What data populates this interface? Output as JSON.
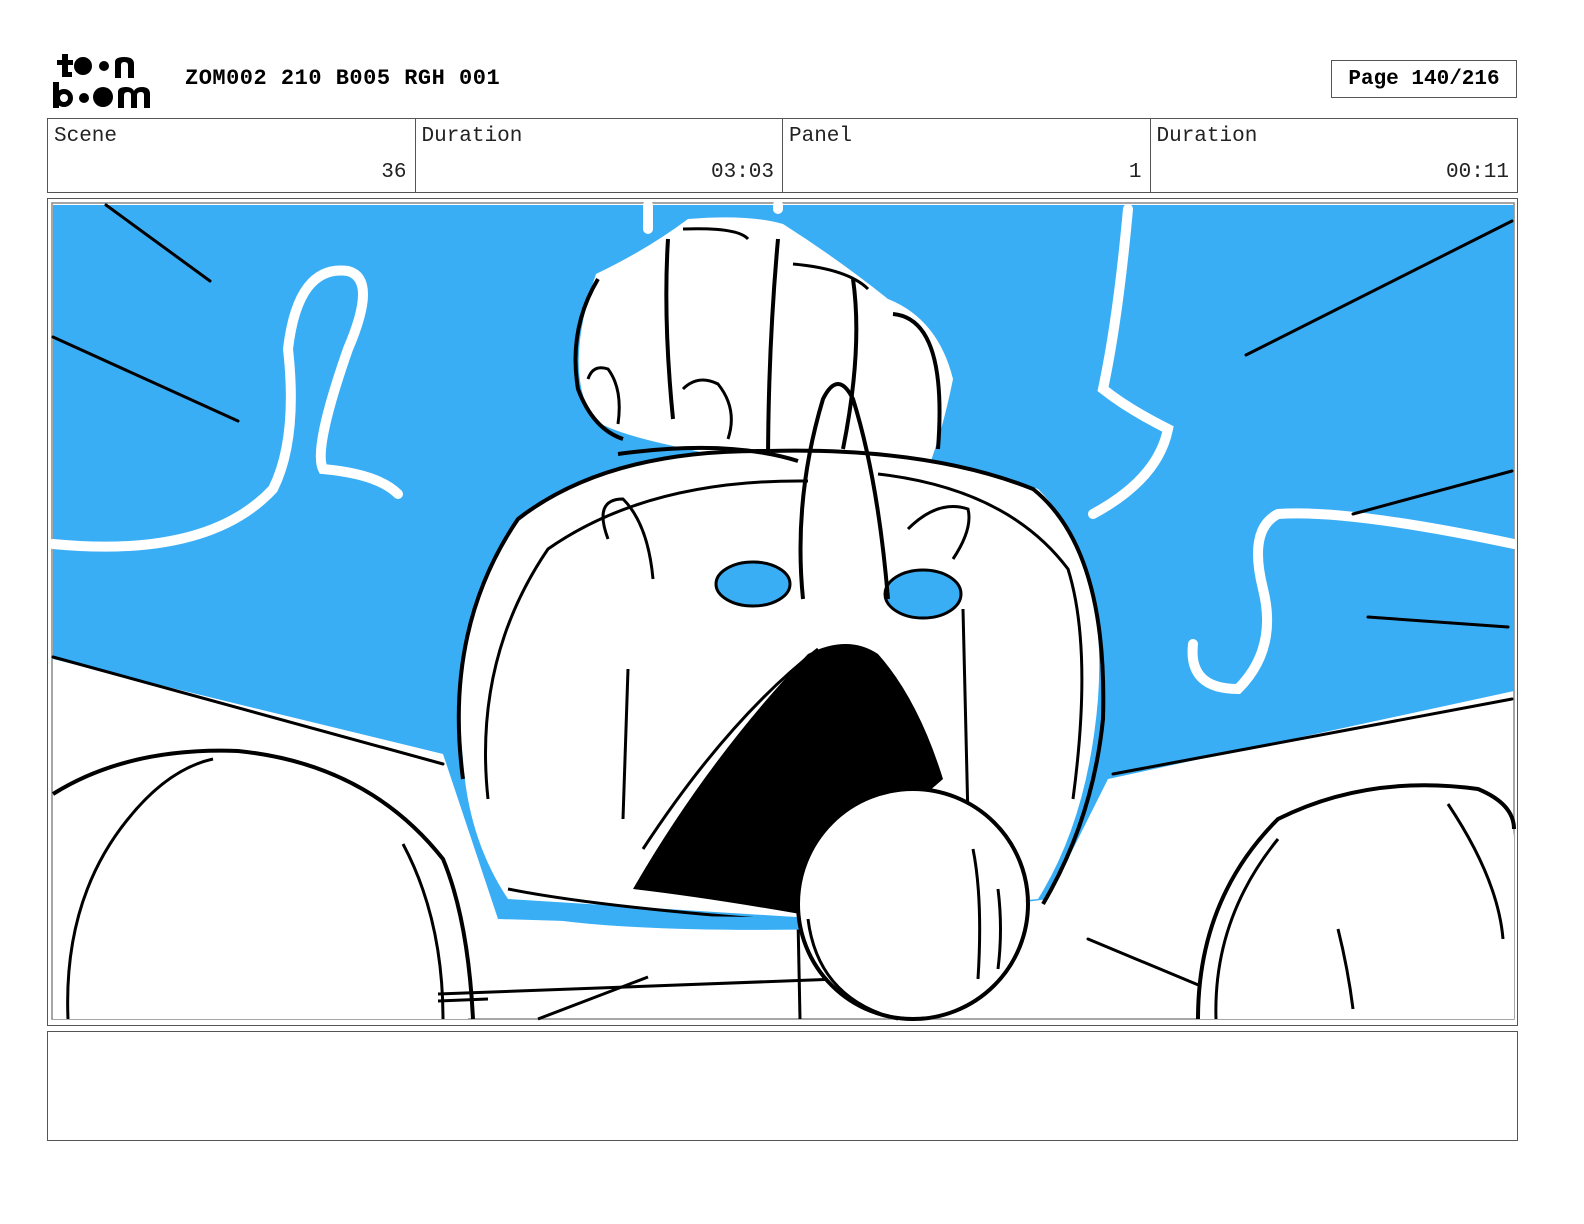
{
  "header": {
    "logo_top": "toon",
    "logo_bottom": "boom",
    "project_code": "ZOM002 210 B005 RGH 001",
    "page_label": "Page 140/216"
  },
  "info": {
    "scene_label": "Scene",
    "scene_value": "36",
    "scene_duration_label": "Duration",
    "scene_duration_value": "03:03",
    "panel_label": "Panel",
    "panel_value": "1",
    "panel_duration_label": "Duration",
    "panel_duration_value": "00:11"
  },
  "panel": {
    "sky_color": "#3aaef5",
    "ink_color": "#000000",
    "mouth_color": "#000000"
  },
  "notes": {
    "text": ""
  }
}
